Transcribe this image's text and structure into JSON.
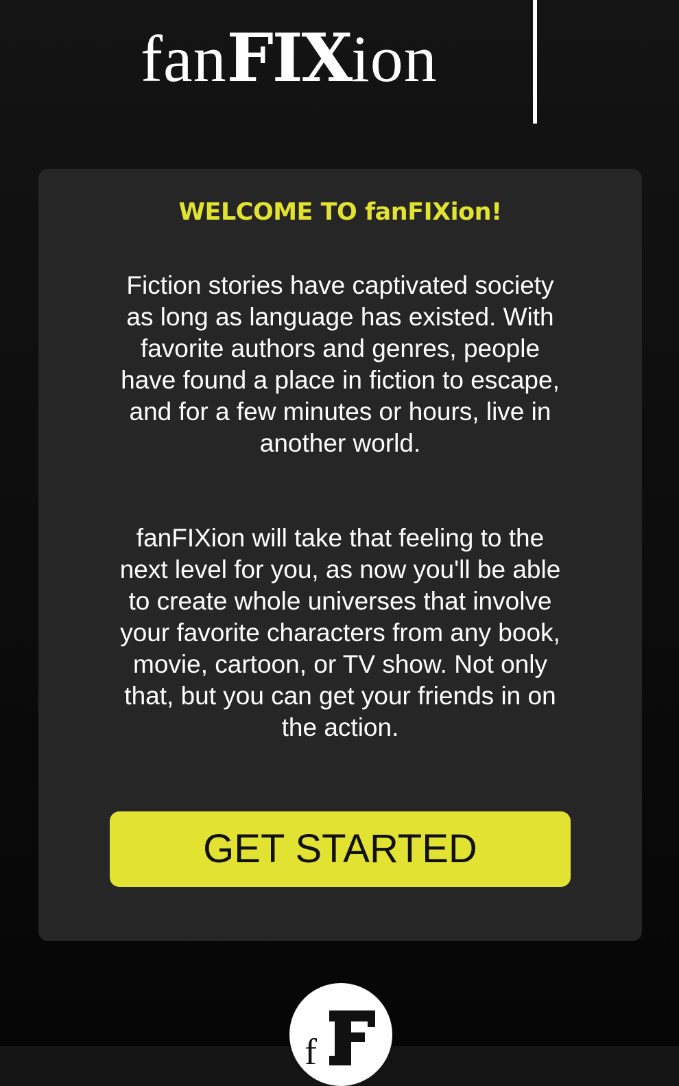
{
  "header": {
    "logo_text": "fanFIXion",
    "logo_parts": [
      "fan",
      "FIX",
      "ion"
    ]
  },
  "welcome_card": {
    "title": "WELCOME TO fanFIXion!",
    "paragraph_1": "Fiction stories have captivated society as long as language has existed. With favorite authors and genres, people have found a place in fiction to escape, and for a few minutes or hours, live in another world.",
    "paragraph_2": "fanFIXion will take that feeling to the next level for you, as now you'll be able to create whole universes that involve your favorite characters from any book, movie, cartoon, or TV show. Not only that, but you can get your friends in on the action.",
    "cta_label": "GET STARTED"
  },
  "footer": {
    "badge_icon": "fanfixion-ff-logo-icon",
    "badge_letters": "fF"
  },
  "colors": {
    "background": "#0f0f0f",
    "card": "#262626",
    "accent": "#e2e232",
    "text": "#ffffff"
  }
}
